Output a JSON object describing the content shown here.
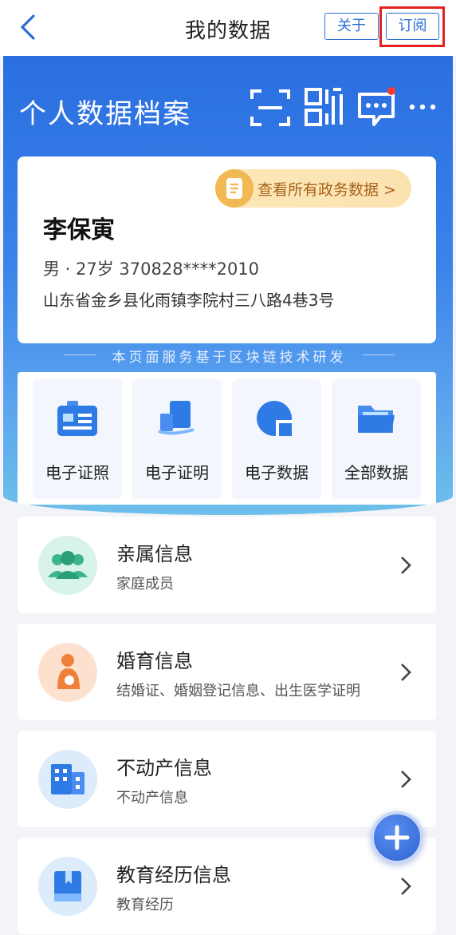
{
  "header": {
    "title": "我的数据",
    "about_label": "关于",
    "subscribe_label": "订阅",
    "highlight_color": "#e5201f"
  },
  "hero": {
    "title": "个人数据档案",
    "icons": [
      "scan-icon",
      "qrcode-icon",
      "message-icon",
      "more-icon"
    ],
    "message_badge_color": "#ff3b30"
  },
  "profile": {
    "gov_data_link": "查看所有政务数据 >",
    "name": "李保寅",
    "meta": "男 · 27岁    370828****2010",
    "address": "山东省金乡县化雨镇李院村三八路4巷3号"
  },
  "blockchain_note": "本页面服务基于区块链技术研发",
  "tiles": [
    {
      "label": "电子证照",
      "icon": "id-card-icon"
    },
    {
      "label": "电子证明",
      "icon": "certificate-icon"
    },
    {
      "label": "电子数据",
      "icon": "data-chart-icon"
    },
    {
      "label": "全部数据",
      "icon": "folder-icon"
    }
  ],
  "list": [
    {
      "title": "亲属信息",
      "subtitle": "家庭成员",
      "icon": "family-icon",
      "color": "#d8f3e8"
    },
    {
      "title": "婚育信息",
      "subtitle": "结婚证、婚姻登记信息、出生医学证明",
      "icon": "pregnancy-icon",
      "color": "#fde1cf"
    },
    {
      "title": "不动产信息",
      "subtitle": "不动产信息",
      "icon": "building-icon",
      "color": "#dcecfb"
    },
    {
      "title": "教育经历信息",
      "subtitle": "教育经历",
      "icon": "book-icon",
      "color": "#dcecfb"
    }
  ],
  "accent_color": "#2c6fd8"
}
